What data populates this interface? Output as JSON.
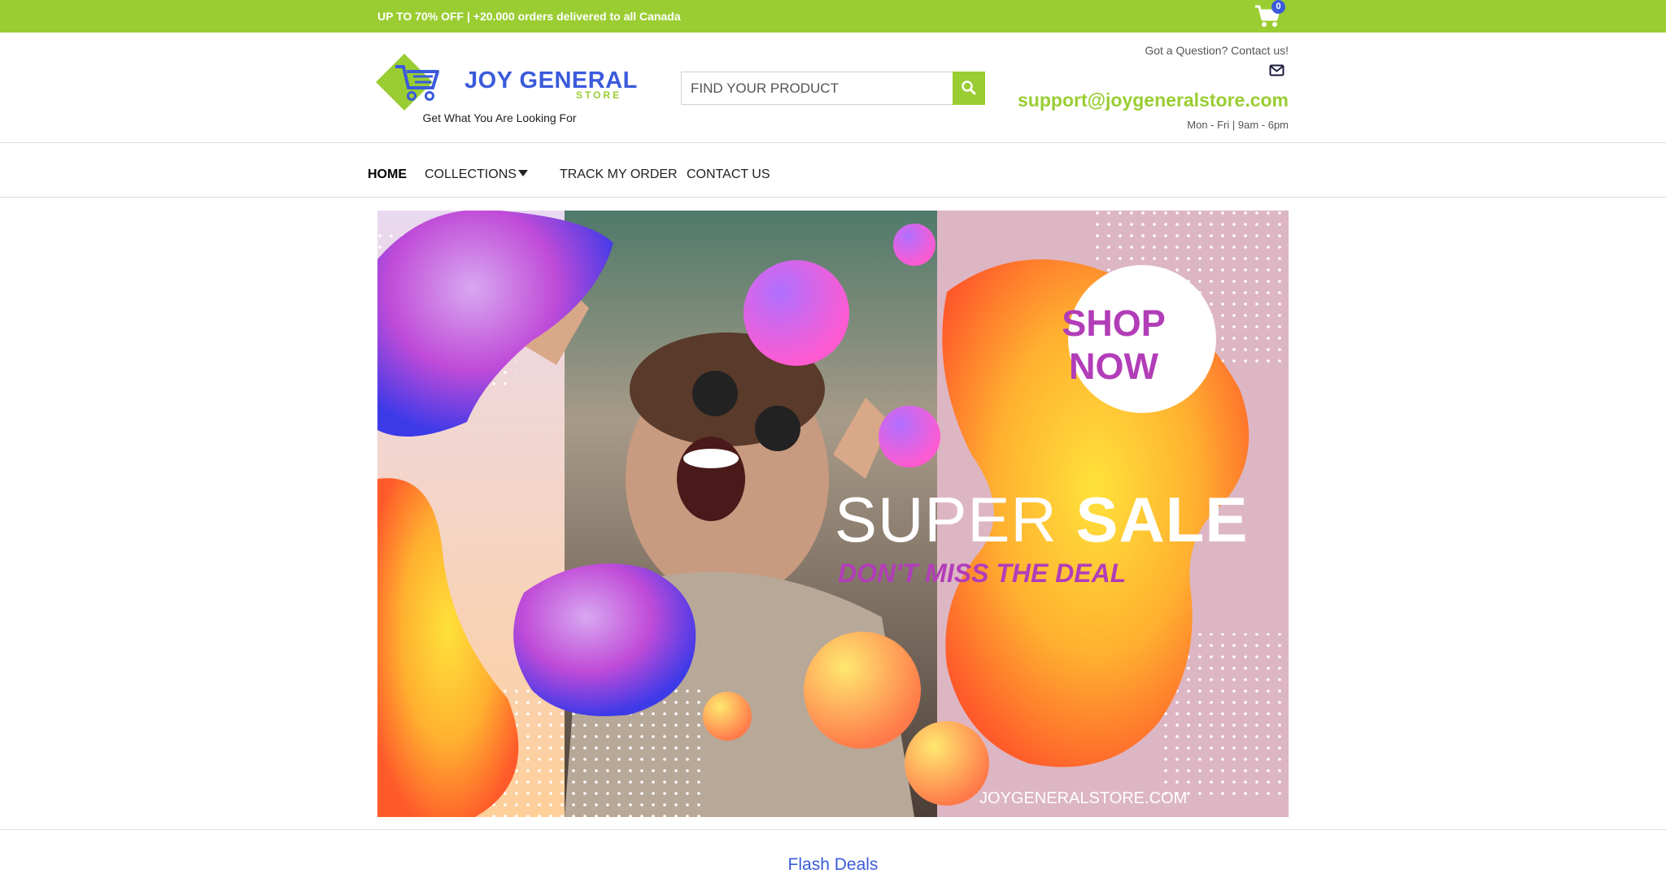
{
  "topbar": {
    "promo": "UP TO 70% OFF | +20.000 orders delivered to all Canada",
    "cart_count": "0",
    "cart_icon": "shopping-cart-icon",
    "bg_color": "#9acd32"
  },
  "header": {
    "logo_name": "JOY GENERAL",
    "logo_sub": "STORE",
    "tagline": "Get What You Are Looking For",
    "search_placeholder": "FIND YOUR PRODUCT",
    "search_icon": "search-icon",
    "contact_prompt": "Got a Question? Contact us!",
    "mail_icon": "mail-icon",
    "email": "support@joygeneralstore.com",
    "hours": "Mon - Fri | 9am - 6pm"
  },
  "nav": {
    "items": [
      {
        "label": "HOME",
        "active": true
      },
      {
        "label": "COLLECTIONS",
        "has_dropdown": true
      },
      {
        "label": "TRACK MY ORDER"
      },
      {
        "label": "CONTACT US"
      }
    ]
  },
  "banner": {
    "shop_line1": "SHOP",
    "shop_line2": "NOW",
    "super_word1": "SUPER",
    "super_word2": "SALE",
    "deal": "DON'T MISS THE DEAL",
    "site": "JOYGENERALSTORE.COM"
  },
  "sections": {
    "flash_deals": "Flash Deals"
  },
  "colors": {
    "accent": "#9acd32",
    "brand_blue": "#3b5bdb",
    "banner_magenta": "#b23db8"
  }
}
